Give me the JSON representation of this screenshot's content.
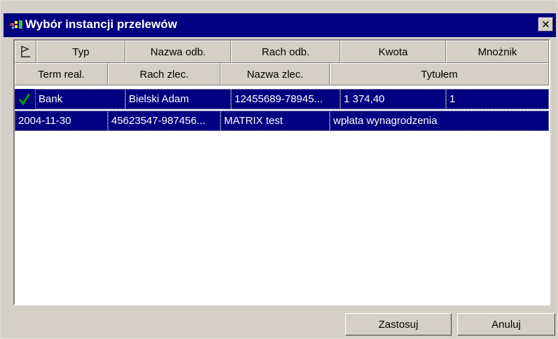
{
  "window": {
    "title": "Wybór instancji przelewów",
    "close_symbol": "✕",
    "app_icon": "transfer-app-icon"
  },
  "list": {
    "header_row1": [
      "Typ",
      "Nazwa odb.",
      "Rach odb.",
      "Kwota",
      "Mnożnik"
    ],
    "header_row2": [
      "Term real.",
      "Rach zlec.",
      "Nazwa zlec.",
      "Tytułem"
    ],
    "sort_icon": "sort-icon",
    "check_icon": "checkmark-icon",
    "check_color": "#00a000",
    "selection_color": "#000080",
    "rows": [
      [
        "Bank",
        "Bielski Adam",
        "12455689-78945...",
        "1 374,40",
        "1"
      ],
      [
        "2004-11-30",
        "45623547-987456...",
        "MATRIX test",
        "wpłata wynagrodzenia"
      ]
    ]
  },
  "buttons": {
    "apply": "Zastosuj",
    "cancel": "Anuluj"
  }
}
